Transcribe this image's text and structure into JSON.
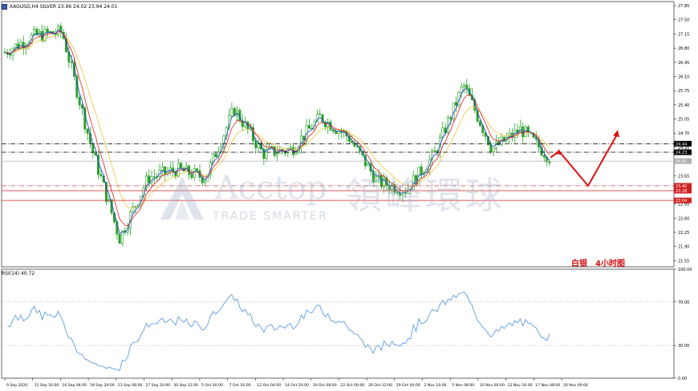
{
  "header": {
    "text": "XAGUSD,H4  SILVER  23.96 24.02 23.94 24.01"
  },
  "rsi_label": "RSI(14) 40.72",
  "annotation": {
    "asset": "白银",
    "timeframe": "4小时图"
  },
  "watermark": {
    "brand_en": "Acctop",
    "brand_cn": "領峰環球",
    "tagline": "TRADE SMARTER"
  },
  "colors": {
    "candle": "#2aa12a",
    "ma_fast": "#1f3fd0",
    "ma_mid": "#e02020",
    "ma_slow": "#f0c43a",
    "rsi_line": "#4a90e2",
    "forecast": "#e01010",
    "level_dashdot": "#000000",
    "level_red": "#d02020",
    "watermark": "#a0afc8"
  },
  "chart_data": [
    {
      "type": "candlestick",
      "title": "XAGUSD,H4 SILVER",
      "y_axis": {
        "range": [
          21.4,
          27.95
        ],
        "ticks": [
          27.85,
          27.5,
          27.15,
          26.8,
          26.45,
          26.1,
          25.75,
          25.4,
          25.05,
          24.7,
          24.35,
          24.0,
          23.65,
          23.3,
          22.95,
          22.6,
          22.25,
          21.9,
          21.55
        ]
      },
      "x_axis": {
        "ticks": [
          "9 Sep 2020",
          "11 Sep 16:00",
          "16 Sep 04:00",
          "18 Sep 20:00",
          "23 Sep 08:00",
          "27 Sep 20:00",
          "30 Sep 12:00",
          "5 Oct 00:00",
          "7 Oct 16:00",
          "12 Oct 04:00",
          "14 Oct 20:00",
          "19 Oct 08:00",
          "22 Oct 00:00",
          "26 Oct 12:00",
          "29 Oct 04:00",
          "2 Nov 16:00",
          "5 Nov 08:00",
          "10 Nov 00:00",
          "12 Nov 16:00",
          "17 Nov 08:00",
          "20 Nov 00:00"
        ]
      },
      "price_path": [
        [
          "9 Sep 2020",
          26.7
        ],
        [
          "11 Sep 16:00",
          27.1
        ],
        [
          "16 Sep 04:00",
          27.2
        ],
        [
          "18 Sep 20:00",
          24.4
        ],
        [
          "23 Sep 08:00",
          22.1
        ],
        [
          "27 Sep 20:00",
          23.6
        ],
        [
          "30 Sep 12:00",
          23.8
        ],
        [
          "5 Oct 00:00",
          23.6
        ],
        [
          "7 Oct 16:00",
          25.3
        ],
        [
          "12 Oct 04:00",
          24.2
        ],
        [
          "14 Oct 20:00",
          24.3
        ],
        [
          "19 Oct 08:00",
          25.1
        ],
        [
          "22 Oct 00:00",
          24.6
        ],
        [
          "26 Oct 12:00",
          23.5
        ],
        [
          "29 Oct 04:00",
          23.3
        ],
        [
          "2 Nov 16:00",
          24.2
        ],
        [
          "5 Nov 08:00",
          25.9
        ],
        [
          "10 Nov 00:00",
          24.3
        ],
        [
          "12 Nov 16:00",
          24.8
        ],
        [
          "17 Nov 08:00",
          24.1
        ]
      ],
      "price_labels": [
        "24.44",
        "24.23",
        "24.01",
        "23.40",
        "23.28",
        "23.04"
      ],
      "levels": [
        {
          "value": 24.44,
          "style": "dash-dot"
        },
        {
          "value": 24.23,
          "style": "dash-dot"
        },
        {
          "value": 24.01,
          "style": "solid-gray"
        },
        {
          "value": 23.4,
          "style": "dash-dot-red"
        },
        {
          "value": 23.28,
          "style": "solid-red"
        },
        {
          "value": 23.04,
          "style": "solid-red"
        }
      ],
      "forecast_path": [
        24.1,
        24.25,
        23.4,
        24.7
      ]
    },
    {
      "type": "line",
      "title": "RSI(14) 40.72",
      "y_axis": {
        "range": [
          0,
          100
        ],
        "ticks": [
          100.0,
          70.0,
          30.0,
          0.0
        ]
      },
      "levels": [
        70,
        30
      ],
      "current_value": 40.72
    }
  ]
}
